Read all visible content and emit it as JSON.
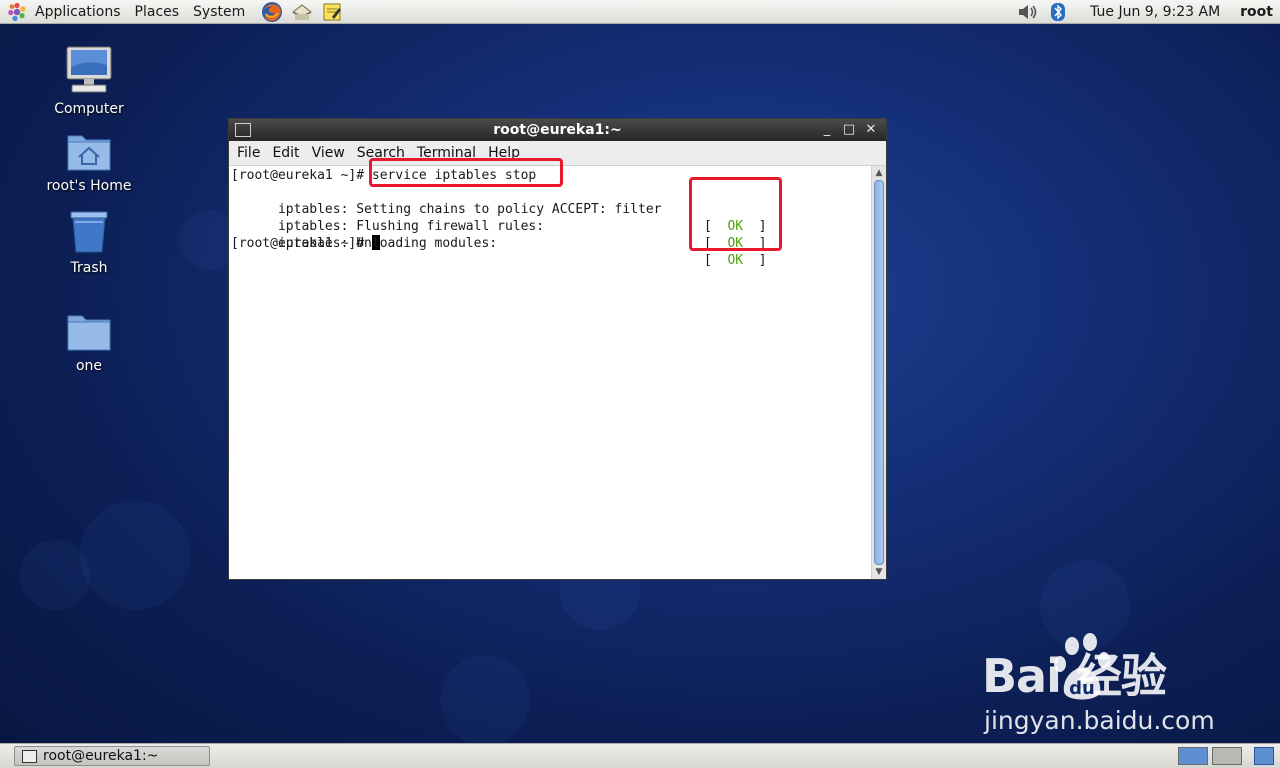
{
  "top_panel": {
    "menus": [
      "Applications",
      "Places",
      "System"
    ],
    "clock": "Tue Jun  9,  9:23 AM",
    "user": "root"
  },
  "desktop_icons": [
    "Computer",
    "root's Home",
    "Trash",
    "one"
  ],
  "terminal": {
    "title": "root@eureka1:~",
    "menus": [
      "File",
      "Edit",
      "View",
      "Search",
      "Terminal",
      "Help"
    ],
    "lines": [
      "[root@eureka1 ~]# service iptables stop",
      "iptables: Setting chains to policy ACCEPT: filter",
      "iptables: Flushing firewall rules:",
      "iptables: Unloading modules:",
      "[root@eureka1 ~]# "
    ],
    "status_open": "[  ",
    "status_ok": "OK",
    "status_close": "  ]",
    "window_buttons": [
      "_",
      "□",
      "✕"
    ]
  },
  "taskbar": {
    "task_label": "root@eureka1:~"
  },
  "watermark": {
    "main": "Bai 经验",
    "brand_mid": "du",
    "sub": "jingyan.baidu.com"
  },
  "colors": {
    "ok_green": "#4ea20a",
    "highlight_red": "#e8192b",
    "title_bar": "#2e2e2e"
  },
  "icons": [
    "gnome-foot-icon",
    "firefox-icon",
    "mail-icon",
    "notes-icon",
    "volume-icon",
    "bluetooth-icon",
    "computer-icon",
    "home-folder-icon",
    "trash-icon",
    "folder-icon",
    "terminal-icon"
  ]
}
